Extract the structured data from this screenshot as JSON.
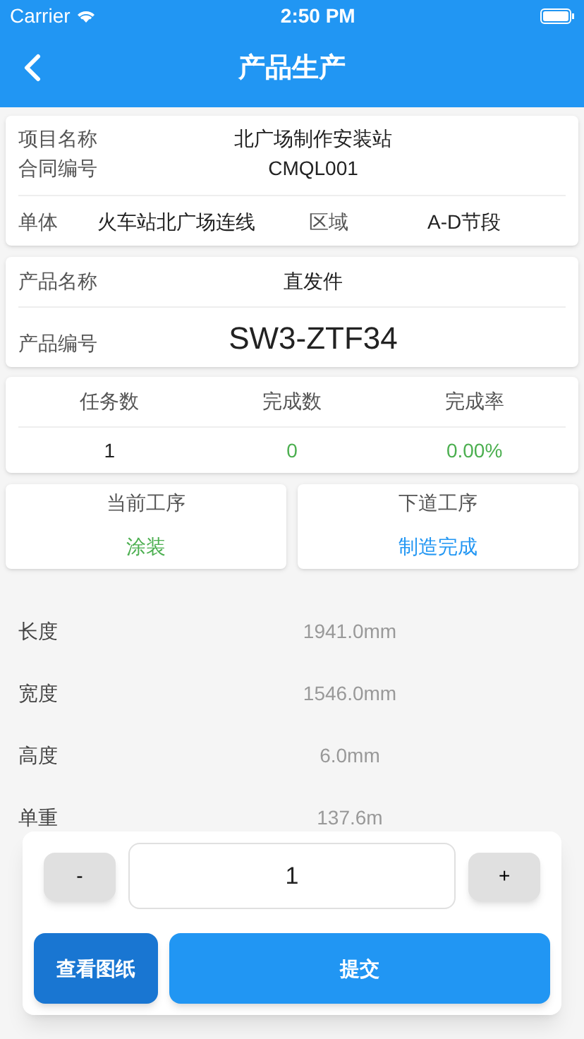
{
  "status_bar": {
    "carrier": "Carrier",
    "time": "2:50 PM"
  },
  "header": {
    "title": "产品生产"
  },
  "project": {
    "name_label": "项目名称",
    "name": "北广场制作安装站",
    "contract_label": "合同编号",
    "contract": "CMQL001",
    "unit_label": "单体",
    "unit": "火车站北广场连线",
    "area_label": "区域",
    "area": "A-D节段"
  },
  "product": {
    "name_label": "产品名称",
    "name": "直发件",
    "code_label": "产品编号",
    "code": "SW3-ZTF34"
  },
  "stats": {
    "columns": [
      "任务数",
      "完成数",
      "完成率"
    ],
    "values": [
      {
        "text": "1",
        "color": "#222222"
      },
      {
        "text": "0",
        "color": "#4caf50"
      },
      {
        "text": "0.00%",
        "color": "#4caf50"
      }
    ]
  },
  "processes": [
    {
      "label": "当前工序",
      "value": "涂装",
      "color": "#4caf50"
    },
    {
      "label": "下道工序",
      "value": "制造完成",
      "color": "#2196f3"
    }
  ],
  "specs": [
    {
      "label": "长度",
      "value": "1941.0mm"
    },
    {
      "label": "宽度",
      "value": "1546.0mm"
    },
    {
      "label": "高度",
      "value": "6.0mm"
    },
    {
      "label": "单重",
      "value": "137.6m"
    }
  ],
  "quantity_panel": {
    "minus": "-",
    "quantity": "1",
    "plus": "+",
    "view_button": "查看图纸",
    "submit_button": "提交"
  }
}
